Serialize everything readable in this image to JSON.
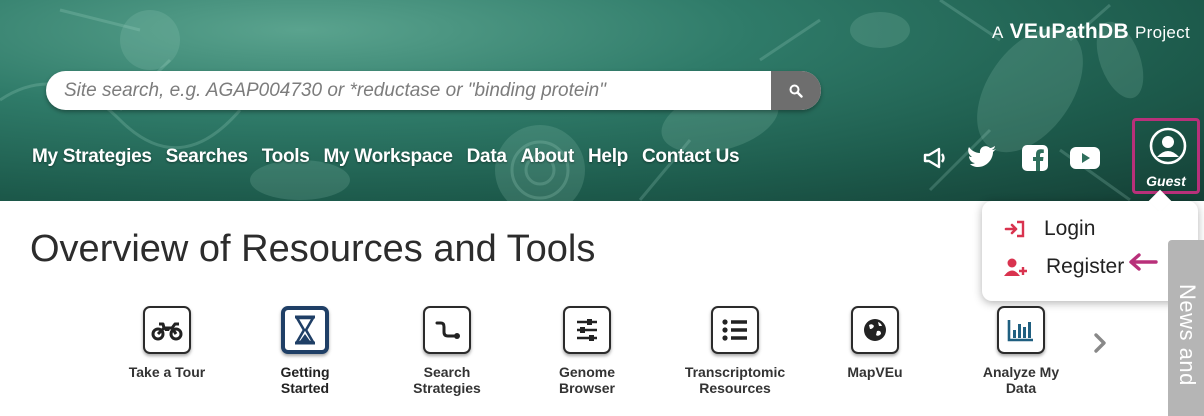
{
  "brand": {
    "prefix": "A",
    "name": "VEuPathDB",
    "suffix": "Project"
  },
  "search": {
    "placeholder": "Site search, e.g. AGAP004730 or *reductase or \"binding protein\"",
    "value": ""
  },
  "nav": [
    "My Strategies",
    "Searches",
    "Tools",
    "My Workspace",
    "Data",
    "About",
    "Help",
    "Contact Us"
  ],
  "social_icons": [
    "megaphone-icon",
    "twitter-icon",
    "facebook-icon",
    "youtube-icon"
  ],
  "user": {
    "label": "Guest",
    "icon": "user-circle-icon"
  },
  "dropdown": {
    "login": "Login",
    "register": "Register"
  },
  "page_title": "Overview of Resources and Tools",
  "tools": [
    {
      "label": "Take a Tour",
      "icon": "motorcycle-icon"
    },
    {
      "label": "Getting Started",
      "icon": "hourglass-icon",
      "active": true
    },
    {
      "label": "Search Strategies",
      "icon": "strategy-icon"
    },
    {
      "label": "Genome Browser",
      "icon": "sliders-icon"
    },
    {
      "label": "Transcriptomic Resources",
      "icon": "list-icon"
    },
    {
      "label": "MapVEu",
      "icon": "globe-icon"
    },
    {
      "label": "Analyze My Data",
      "icon": "bar-chart-icon"
    }
  ],
  "news_tab": "News and",
  "colors": {
    "accent": "#b8307a",
    "active_border": "#1f3f66",
    "header": "#2f7b69"
  }
}
